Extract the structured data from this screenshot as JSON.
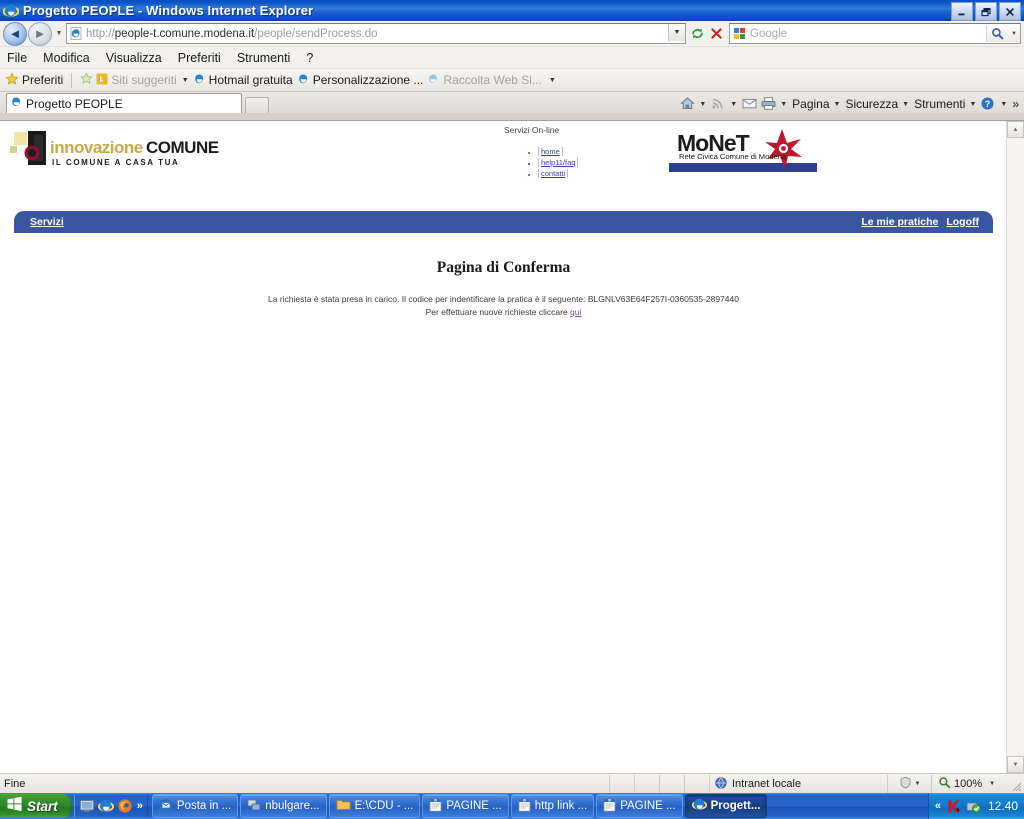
{
  "window": {
    "title": "Progetto PEOPLE - Windows Internet Explorer",
    "minimize_label": "_",
    "maximize_label": "❐",
    "close_label": "✕"
  },
  "address_bar": {
    "url_protocol": "http://",
    "url_host": "people-t.comune.modena.it",
    "url_path": "/people/sendProcess.do",
    "dropdown_icon": "chevron-down-icon",
    "refresh_icon": "refresh-icon",
    "stop_icon": "stop-icon",
    "back_icon": "back-arrow-icon",
    "forward_icon": "forward-arrow-icon"
  },
  "search": {
    "placeholder": "Google",
    "provider_icon": "google-icon",
    "go_icon": "magnifier-icon",
    "dropdown_icon": "chevron-down-icon"
  },
  "menu": {
    "items": [
      {
        "label": "File"
      },
      {
        "label": "Modifica"
      },
      {
        "label": "Visualizza"
      },
      {
        "label": "Preferiti"
      },
      {
        "label": "Strumenti"
      },
      {
        "label": "?"
      }
    ]
  },
  "favorites_bar": {
    "favorites_label": "Preferiti",
    "items": [
      {
        "label": "Siti suggeriti",
        "dim": true,
        "icon": "bing-icon",
        "caret": true
      },
      {
        "label": "Hotmail gratuita",
        "dim": false,
        "icon": "ie-icon",
        "caret": false
      },
      {
        "label": "Personalizzazione ...",
        "dim": false,
        "icon": "ie-icon",
        "caret": false
      },
      {
        "label": "Raccolta Web Sl...",
        "dim": true,
        "icon": "ie-icon",
        "caret": false
      }
    ],
    "overflow_caret": "▼"
  },
  "tabs": {
    "items": [
      {
        "label": "Progetto PEOPLE"
      }
    ],
    "new_tab_label": ""
  },
  "command_bar": {
    "home_icon": "home-icon",
    "feeds_icon": "rss-icon",
    "mail_icon": "mail-icon",
    "print_icon": "print-icon",
    "items": [
      {
        "label": "Pagina"
      },
      {
        "label": "Sicurezza"
      },
      {
        "label": "Strumenti"
      }
    ],
    "help_icon": "help-icon",
    "overflow_label": "»"
  },
  "page": {
    "logo": {
      "name_part1": "innovazione",
      "name_part2": "COMUNE",
      "tagline": "IL COMUNE A CASA TUA"
    },
    "servizi_online": "Servizi On-line",
    "header_links": [
      {
        "label": "home"
      },
      {
        "label": "help11/faq"
      },
      {
        "label": "contatti"
      }
    ],
    "monet": {
      "title": "MoNeT",
      "subtitle": "Rete Civica Comune di Modena"
    },
    "nav": {
      "left": [
        {
          "label": "Servizi"
        }
      ],
      "right": [
        {
          "label": "Le mie pratiche"
        },
        {
          "label": "Logoff"
        }
      ]
    },
    "confirmation": {
      "heading": "Pagina di Conferma",
      "line1_prefix": "La richiesta è stata presa in carico. Il codice per indentificare la pratica è il seguente: ",
      "reference_code": "BLGNLV63E64F257I-0360535-2897440",
      "line2_prefix": "Per effettuare nuove richieste cliccare ",
      "line2_link": "qui"
    }
  },
  "status_bar": {
    "message": "Fine",
    "zone": "Intranet locale",
    "zone_icon": "globe-icon",
    "security_icon": "security-icon",
    "zoom_icon": "zoom-icon",
    "zoom_level": "100%",
    "caret": "▼"
  },
  "taskbar": {
    "start_label": "Start",
    "quick_launch": [
      {
        "icon": "show-desktop-icon"
      },
      {
        "icon": "ie-icon"
      },
      {
        "icon": "firefox-icon"
      }
    ],
    "quick_launch_more": "»",
    "items": [
      {
        "label": "Posta in ...",
        "icon": "outlook-icon",
        "active": false
      },
      {
        "label": "nbulgare...",
        "icon": "network-icon",
        "active": false
      },
      {
        "label": "E:\\CDU - ...",
        "icon": "folder-icon",
        "active": false
      },
      {
        "label": "PAGINE ...",
        "icon": "word-icon",
        "active": false
      },
      {
        "label": "http link ...",
        "icon": "word-icon",
        "active": false
      },
      {
        "label": "PAGINE ...",
        "icon": "word-icon",
        "active": false
      },
      {
        "label": "Progett...",
        "icon": "ie-icon",
        "active": true
      }
    ],
    "tray": {
      "expand_label": "«",
      "icons": [
        {
          "icon": "kaspersky-icon"
        },
        {
          "icon": "updates-icon"
        }
      ],
      "clock": "12.40"
    }
  },
  "colors": {
    "title_bar_blue": "#0a4fc0",
    "site_nav_blue": "#3a55a0",
    "link_purple": "#3b3bb0",
    "visited_link": "#7a4fa0",
    "taskbar_blue": "#2560c2",
    "start_green": "#2f8a2a",
    "monet_red": "#c0152a"
  }
}
